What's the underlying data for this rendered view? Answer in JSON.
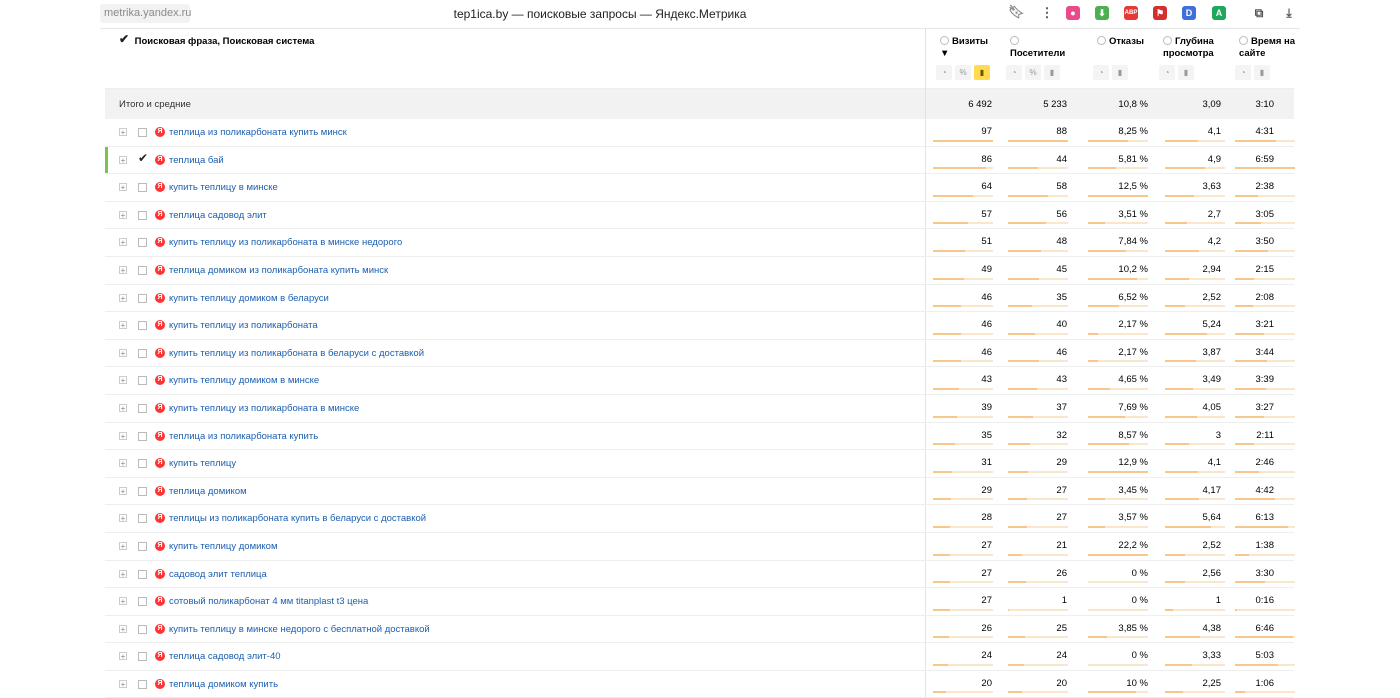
{
  "browser": {
    "url": "metrika.yandex.ru",
    "title": "tep1ica.by — поисковые запросы — Яндекс.Метрика",
    "extensions": [
      {
        "name": "colorpicker-icon",
        "color": "#e94b8a",
        "glyph": "●"
      },
      {
        "name": "download-icon",
        "color": "#4caf50",
        "glyph": "⬇"
      },
      {
        "name": "adblock-icon",
        "color": "#e53935",
        "glyph": "ABP"
      },
      {
        "name": "flag-icon",
        "color": "#d32f2f",
        "glyph": "⚑"
      },
      {
        "name": "d-icon",
        "color": "#3f6fd8",
        "glyph": "D"
      },
      {
        "name": "a-icon",
        "color": "#1ea85b",
        "glyph": "A"
      }
    ]
  },
  "report": {
    "dimension_header": "Поисковая фраза, Поисковая система",
    "metrics": [
      {
        "label": "Визиты ▼"
      },
      {
        "label": "Посетители"
      },
      {
        "label": "Отказы"
      },
      {
        "label": "Глубина просмотра"
      },
      {
        "label": "Время на сайте"
      }
    ],
    "totals_label": "Итого и средние",
    "totals": [
      "6 492",
      "5 233",
      "10,8 %",
      "3,09",
      "3:10"
    ],
    "rows": [
      {
        "phrase": "теплица из поликарбоната купить минск",
        "v": [
          "97",
          "88",
          "8,25 %",
          "4,1",
          "4:31"
        ],
        "f": [
          1.0,
          1.0,
          0.66,
          0.55,
          0.68
        ]
      },
      {
        "phrase": "теплица бай",
        "selected": true,
        "v": [
          "86",
          "44",
          "5,81 %",
          "4,9",
          "6:59"
        ],
        "f": [
          0.89,
          0.5,
          0.46,
          0.66,
          1.0
        ]
      },
      {
        "phrase": "купить теплицу в минске",
        "v": [
          "64",
          "58",
          "12,5 %",
          "3,63",
          "2:38"
        ],
        "f": [
          0.66,
          0.66,
          1.0,
          0.49,
          0.38
        ]
      },
      {
        "phrase": "теплица садовод элит",
        "v": [
          "57",
          "56",
          "3,51 %",
          "2,7",
          "3:05"
        ],
        "f": [
          0.59,
          0.64,
          0.28,
          0.36,
          0.44
        ]
      },
      {
        "phrase": "купить теплицу из поликарбоната в минске недорого",
        "v": [
          "51",
          "48",
          "7,84 %",
          "4,2",
          "3:50"
        ],
        "f": [
          0.53,
          0.55,
          0.63,
          0.57,
          0.55
        ]
      },
      {
        "phrase": "теплица домиком из поликарбоната купить минск",
        "v": [
          "49",
          "45",
          "10,2 %",
          "2,94",
          "2:15"
        ],
        "f": [
          0.51,
          0.51,
          0.82,
          0.4,
          0.32
        ]
      },
      {
        "phrase": "купить теплицу домиком в беларуси",
        "v": [
          "46",
          "35",
          "6,52 %",
          "2,52",
          "2:08"
        ],
        "f": [
          0.47,
          0.4,
          0.52,
          0.34,
          0.3
        ]
      },
      {
        "phrase": "купить теплицу из поликарбоната",
        "v": [
          "46",
          "40",
          "2,17 %",
          "5,24",
          "3:21"
        ],
        "f": [
          0.47,
          0.45,
          0.17,
          0.7,
          0.48
        ]
      },
      {
        "phrase": "купить теплицу из поликарбоната в беларуси с доставкой",
        "v": [
          "46",
          "46",
          "2,17 %",
          "3,87",
          "3:44"
        ],
        "f": [
          0.47,
          0.52,
          0.17,
          0.52,
          0.53
        ]
      },
      {
        "phrase": "купить теплицу домиком в минске",
        "v": [
          "43",
          "43",
          "4,65 %",
          "3,49",
          "3:39"
        ],
        "f": [
          0.44,
          0.49,
          0.37,
          0.47,
          0.52
        ]
      },
      {
        "phrase": "купить теплицу из поликарбоната в минске",
        "v": [
          "39",
          "37",
          "7,69 %",
          "4,05",
          "3:27"
        ],
        "f": [
          0.4,
          0.42,
          0.62,
          0.54,
          0.49
        ]
      },
      {
        "phrase": "теплица из поликарбоната купить",
        "v": [
          "35",
          "32",
          "8,57 %",
          "3",
          "2:11"
        ],
        "f": [
          0.36,
          0.36,
          0.69,
          0.4,
          0.31
        ]
      },
      {
        "phrase": "купить теплицу",
        "v": [
          "31",
          "29",
          "12,9 %",
          "4,1",
          "2:46"
        ],
        "f": [
          0.32,
          0.33,
          1.0,
          0.55,
          0.4
        ]
      },
      {
        "phrase": "теплица домиком",
        "v": [
          "29",
          "27",
          "3,45 %",
          "4,17",
          "4:42"
        ],
        "f": [
          0.3,
          0.31,
          0.28,
          0.56,
          0.67
        ]
      },
      {
        "phrase": "теплицы из поликарбоната купить в беларуси с доставкой",
        "v": [
          "28",
          "27",
          "3,57 %",
          "5,64",
          "6:13"
        ],
        "f": [
          0.29,
          0.31,
          0.29,
          0.76,
          0.89
        ]
      },
      {
        "phrase": "купить теплицу домиком",
        "v": [
          "27",
          "21",
          "22,2 %",
          "2,52",
          "1:38"
        ],
        "f": [
          0.28,
          0.24,
          1.0,
          0.34,
          0.23
        ]
      },
      {
        "phrase": "садовод элит теплица",
        "v": [
          "27",
          "26",
          "0 %",
          "2,56",
          "3:30"
        ],
        "f": [
          0.28,
          0.3,
          0.0,
          0.34,
          0.5
        ]
      },
      {
        "phrase": "сотовый поликарбонат 4 мм titanplast t3 цена",
        "v": [
          "27",
          "1",
          "0 %",
          "1",
          "0:16"
        ],
        "f": [
          0.28,
          0.01,
          0.0,
          0.13,
          0.04
        ]
      },
      {
        "phrase": "купить теплицу в минске недорого с бесплатной доставкой",
        "v": [
          "26",
          "25",
          "3,85 %",
          "4,38",
          "6:46"
        ],
        "f": [
          0.27,
          0.28,
          0.31,
          0.59,
          0.97
        ]
      },
      {
        "phrase": "теплица садовод элит-40",
        "v": [
          "24",
          "24",
          "0 %",
          "3,33",
          "5:03"
        ],
        "f": [
          0.25,
          0.27,
          0.0,
          0.45,
          0.72
        ]
      },
      {
        "phrase": "теплица домиком купить",
        "v": [
          "20",
          "20",
          "10 %",
          "2,25",
          "1:06"
        ],
        "f": [
          0.21,
          0.23,
          0.8,
          0.3,
          0.16
        ]
      }
    ]
  }
}
